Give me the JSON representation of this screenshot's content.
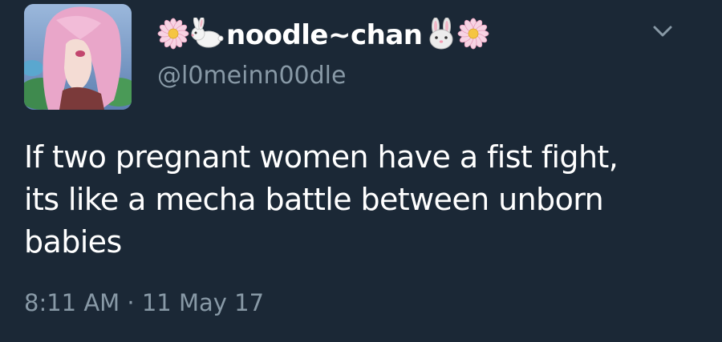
{
  "tweet": {
    "display_name": "noodle~chan",
    "handle": "@l0meinn00dle",
    "text_lines": [
      "If two pregnant women have a fist fight,",
      "its like a mecha battle between unborn",
      "babies"
    ],
    "timestamp": "8:11 AM · 11 May 17"
  },
  "icons": {
    "name_decorations": [
      "flower-icon",
      "rabbit-icon",
      "rabbit-face-icon",
      "flower-icon"
    ],
    "menu": "chevron-down-icon"
  },
  "colors": {
    "background": "#1b2836",
    "text": "#ffffff",
    "secondary_text": "#8899a6"
  }
}
